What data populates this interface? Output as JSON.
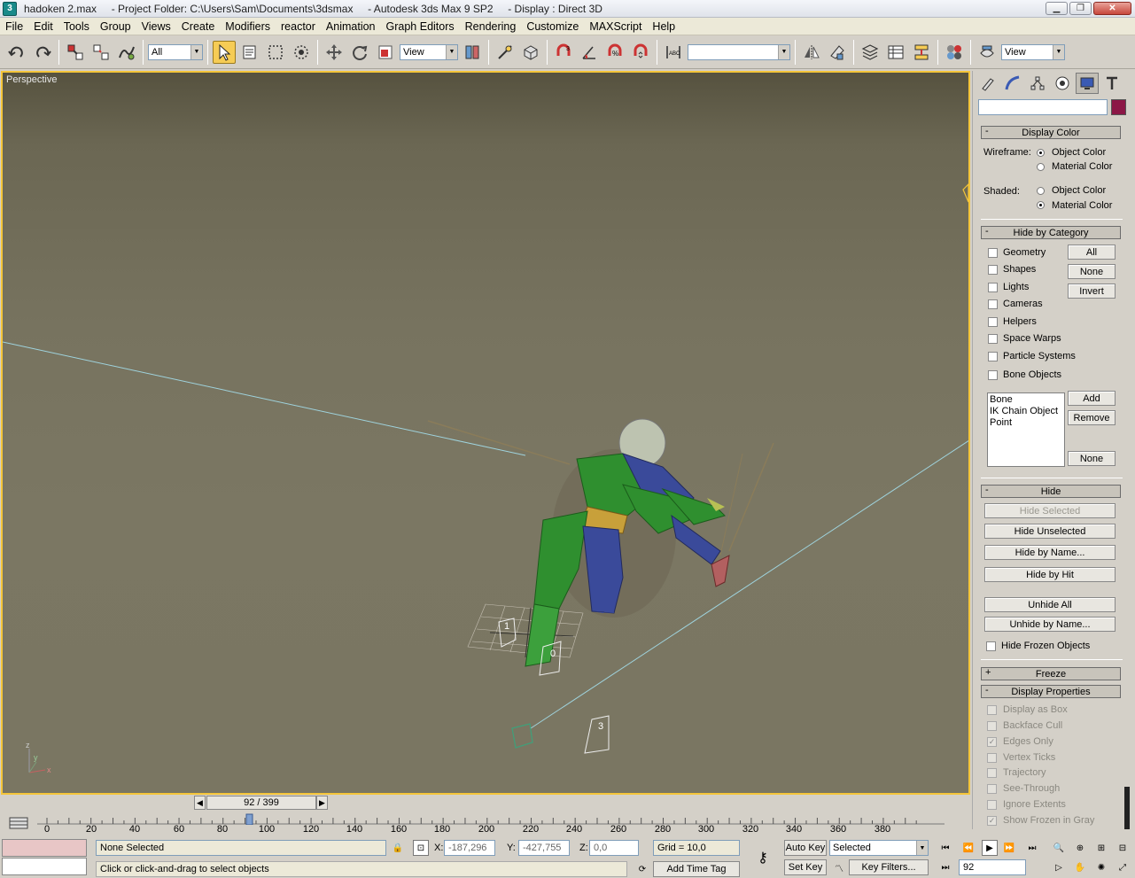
{
  "window": {
    "title": "hadoken 2.max     - Project Folder: C:\\Users\\Sam\\Documents\\3dsmax     - Autodesk 3ds Max 9 SP2     - Display : Direct 3D",
    "logo": "3"
  },
  "menu": [
    "File",
    "Edit",
    "Tools",
    "Group",
    "Views",
    "Create",
    "Modifiers",
    "reactor",
    "Animation",
    "Graph Editors",
    "Rendering",
    "Customize",
    "MAXScript",
    "Help"
  ],
  "toolbar": {
    "selection_filter": "All",
    "ref_coord": "View",
    "snap_percent": "3",
    "named_selection": "",
    "render_view": "View"
  },
  "viewport": {
    "label": "Perspective",
    "markers": [
      "1",
      "0",
      "3"
    ],
    "axis": {
      "x": "x",
      "y": "y",
      "z": "z"
    }
  },
  "cmdpanel": {
    "display_color": {
      "header": "Display Color",
      "wireframe_label": "Wireframe:",
      "shaded_label": "Shaded:",
      "object_color": "Object Color",
      "material_color": "Material Color"
    },
    "hide_by_category": {
      "header": "Hide by Category",
      "items": [
        "Geometry",
        "Shapes",
        "Lights",
        "Cameras",
        "Helpers",
        "Space Warps",
        "Particle Systems",
        "Bone Objects"
      ],
      "btn_all": "All",
      "btn_none": "None",
      "btn_invert": "Invert",
      "list": [
        "Bone",
        "IK Chain Object",
        "Point"
      ],
      "btn_add": "Add",
      "btn_remove": "Remove",
      "btn_none2": "None"
    },
    "hide": {
      "header": "Hide",
      "hide_selected": "Hide Selected",
      "hide_unselected": "Hide Unselected",
      "hide_by_name": "Hide by Name...",
      "hide_by_hit": "Hide by Hit",
      "unhide_all": "Unhide All",
      "unhide_by_name": "Unhide by Name...",
      "hide_frozen": "Hide Frozen Objects"
    },
    "freeze": {
      "header": "Freeze"
    },
    "display_properties": {
      "header": "Display Properties",
      "items": [
        "Display as Box",
        "Backface Cull",
        "Edges Only",
        "Vertex Ticks",
        "Trajectory",
        "See-Through",
        "Ignore Extents",
        "Show Frozen in Gray"
      ]
    }
  },
  "timeline": {
    "slider": "92 / 399",
    "ticks": [
      "0",
      "20",
      "40",
      "60",
      "80",
      "100",
      "120",
      "140",
      "160",
      "180",
      "200",
      "220",
      "240",
      "260",
      "280",
      "300",
      "320",
      "340",
      "360",
      "380"
    ]
  },
  "status": {
    "selection": "None Selected",
    "prompt": "Click or click-and-drag to select objects",
    "x_label": "X:",
    "x_value": "-187,296",
    "y_label": "Y:",
    "y_value": "-427,755",
    "z_label": "Z:",
    "z_value": "0,0",
    "grid": "Grid = 10,0",
    "add_time_tag": "Add Time Tag",
    "auto_key": "Auto Key",
    "set_key": "Set Key",
    "selected": "Selected",
    "key_filters": "Key Filters...",
    "frame": "92"
  }
}
